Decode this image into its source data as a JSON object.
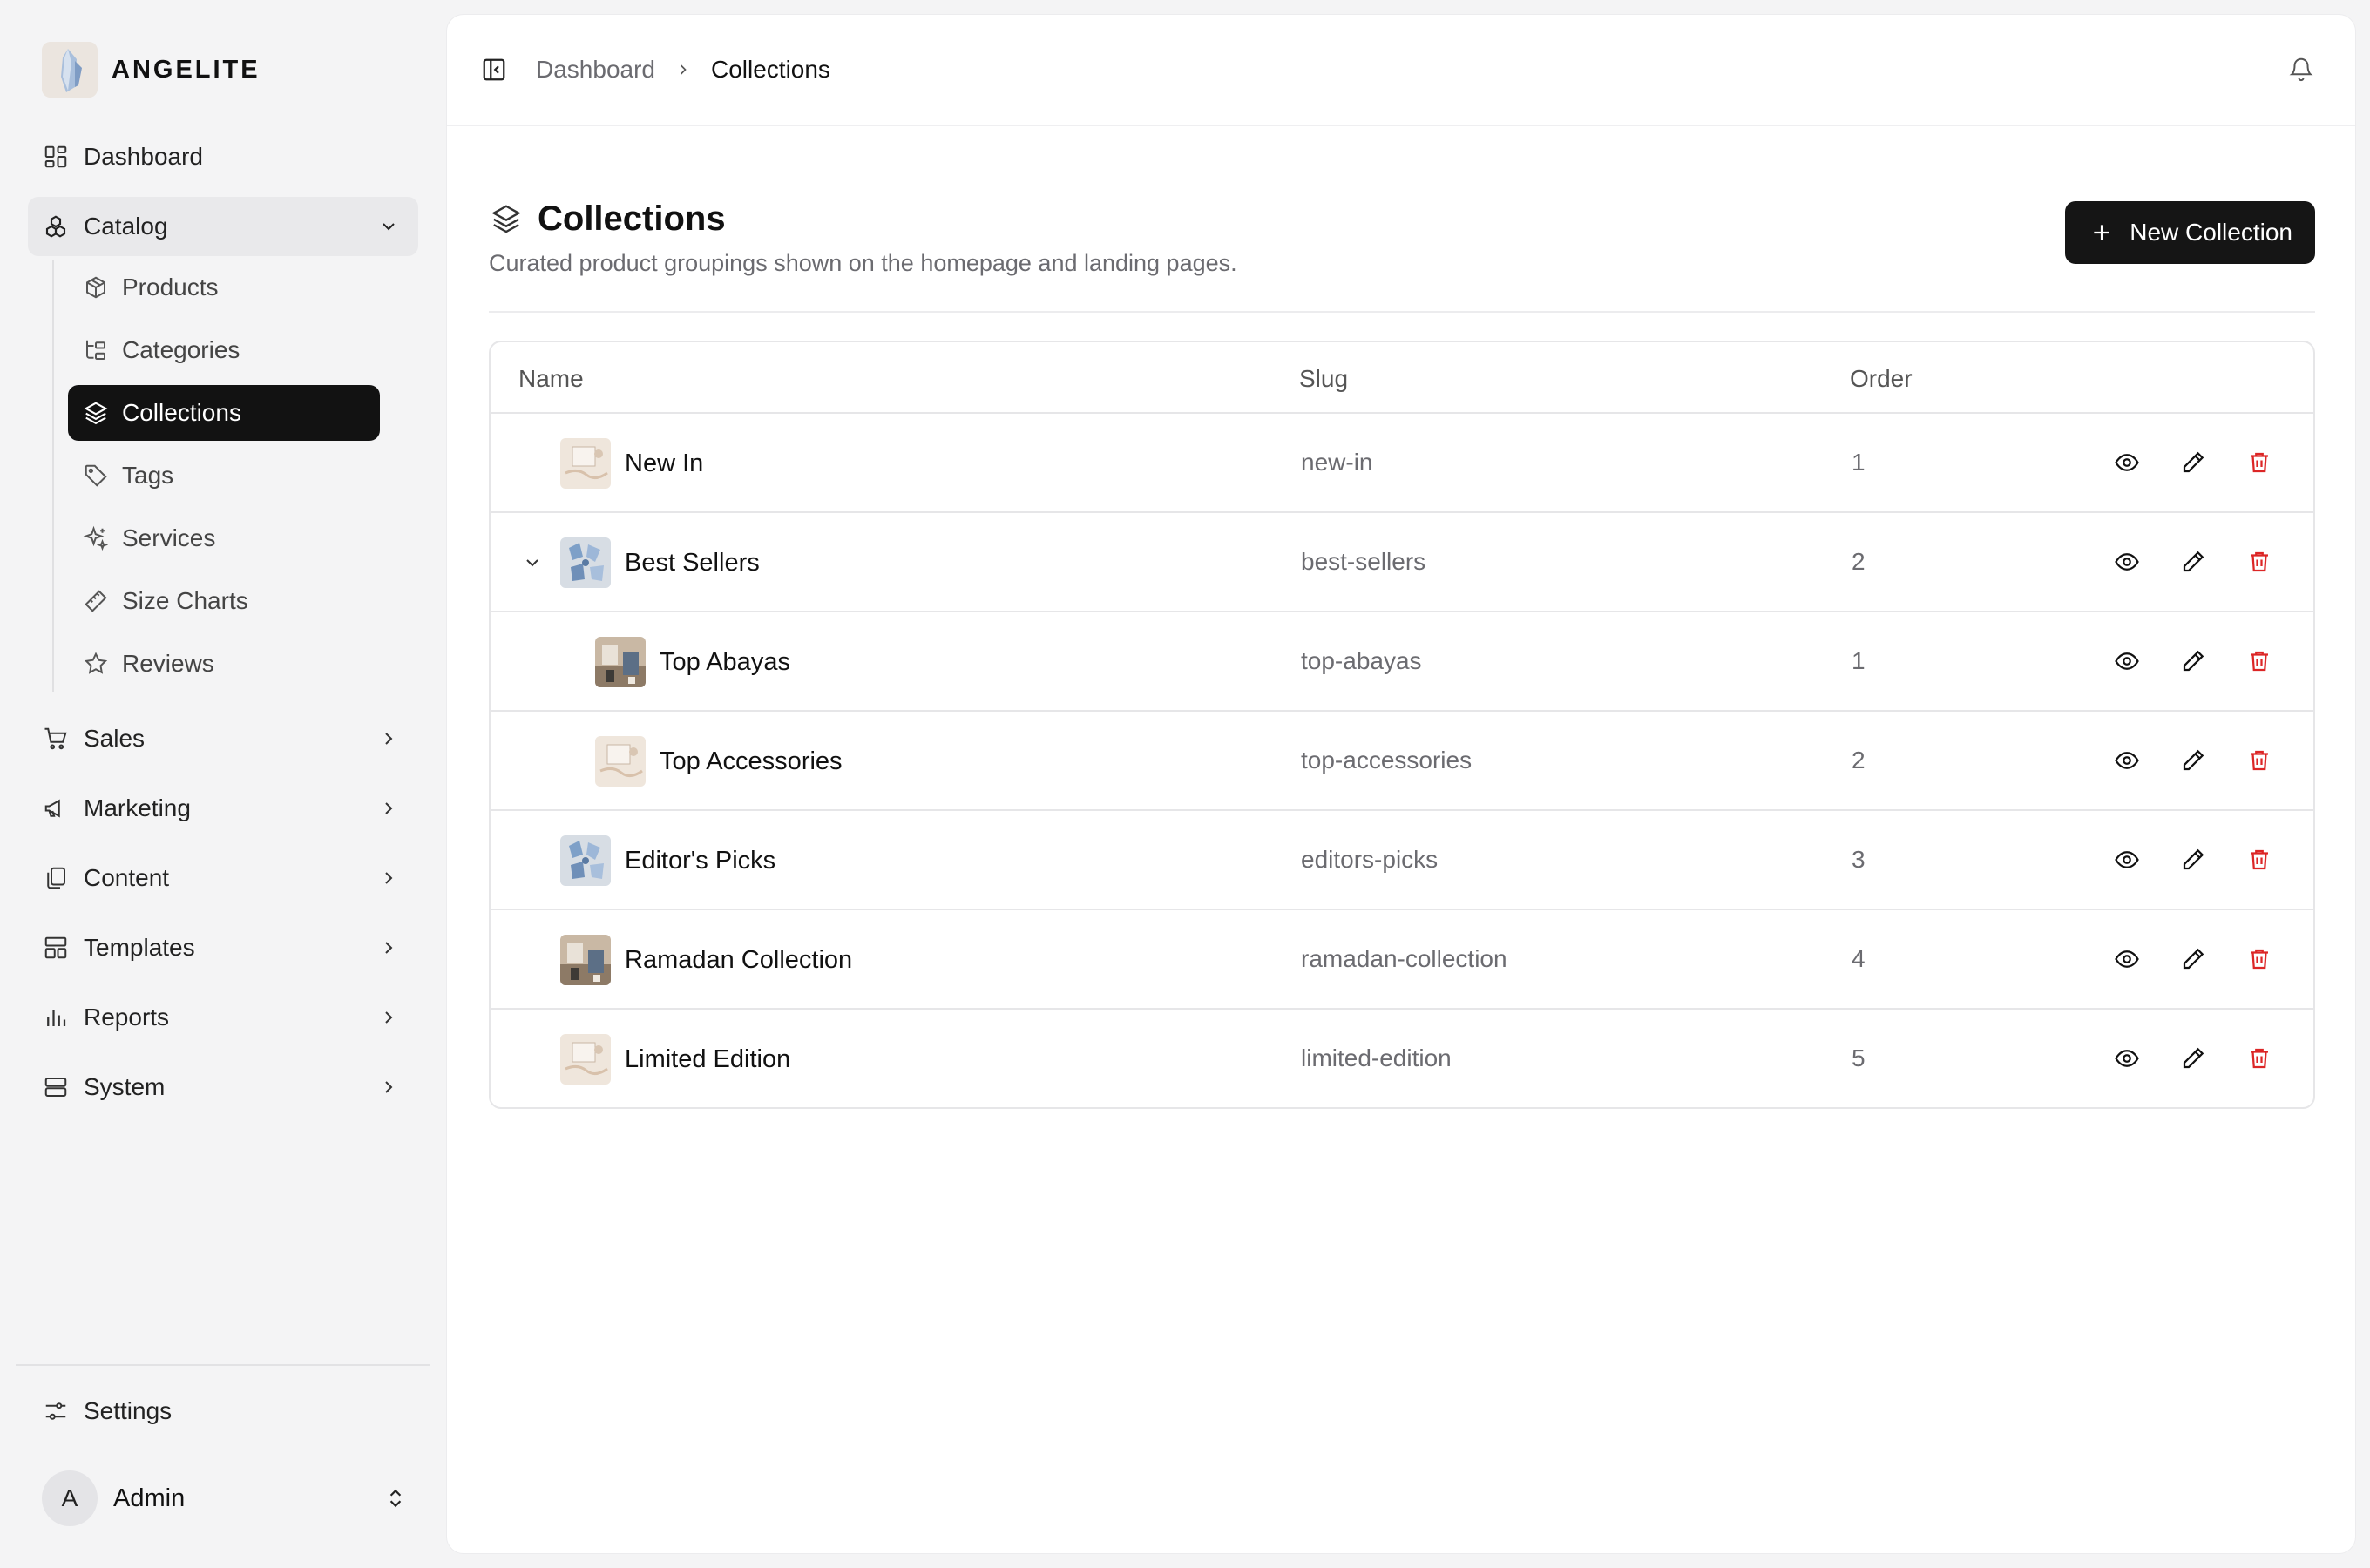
{
  "brand": {
    "name": "ANGELITE"
  },
  "nav": {
    "dashboard": "Dashboard",
    "catalog": "Catalog",
    "catalog_items": [
      {
        "label": "Products",
        "icon": "package-icon"
      },
      {
        "label": "Categories",
        "icon": "hierarchy-icon"
      },
      {
        "label": "Collections",
        "icon": "layers-icon"
      },
      {
        "label": "Tags",
        "icon": "tag-icon"
      },
      {
        "label": "Services",
        "icon": "sparkle-icon"
      },
      {
        "label": "Size Charts",
        "icon": "ruler-icon"
      },
      {
        "label": "Reviews",
        "icon": "star-icon"
      }
    ],
    "groups": [
      {
        "label": "Sales",
        "icon": "cart-icon"
      },
      {
        "label": "Marketing",
        "icon": "megaphone-icon"
      },
      {
        "label": "Content",
        "icon": "copy-icon"
      },
      {
        "label": "Templates",
        "icon": "layout-icon"
      },
      {
        "label": "Reports",
        "icon": "bar-chart-icon"
      },
      {
        "label": "System",
        "icon": "server-icon"
      }
    ],
    "settings": "Settings"
  },
  "user": {
    "initial": "A",
    "name": "Admin"
  },
  "breadcrumb": {
    "parent": "Dashboard",
    "current": "Collections"
  },
  "page": {
    "title": "Collections",
    "subtitle": "Curated product groupings shown on the homepage and landing pages.",
    "new_button": "New Collection"
  },
  "table": {
    "columns": {
      "name": "Name",
      "slug": "Slug",
      "order": "Order"
    },
    "rows": [
      {
        "name": "New In",
        "slug": "new-in",
        "order": "1",
        "level": 0,
        "thumb": "beige"
      },
      {
        "name": "Best Sellers",
        "slug": "best-sellers",
        "order": "2",
        "level": 0,
        "thumb": "blue",
        "expanded": true
      },
      {
        "name": "Top Abayas",
        "slug": "top-abayas",
        "order": "1",
        "level": 1,
        "thumb": "room"
      },
      {
        "name": "Top Accessories",
        "slug": "top-accessories",
        "order": "2",
        "level": 1,
        "thumb": "beige"
      },
      {
        "name": "Editor's Picks",
        "slug": "editors-picks",
        "order": "3",
        "level": 0,
        "thumb": "blue"
      },
      {
        "name": "Ramadan Collection",
        "slug": "ramadan-collection",
        "order": "4",
        "level": 0,
        "thumb": "room"
      },
      {
        "name": "Limited Edition",
        "slug": "limited-edition",
        "order": "5",
        "level": 0,
        "thumb": "beige"
      }
    ]
  },
  "colors": {
    "accent": "#151515",
    "danger": "#dc2626",
    "muted": "#6b6b70"
  }
}
